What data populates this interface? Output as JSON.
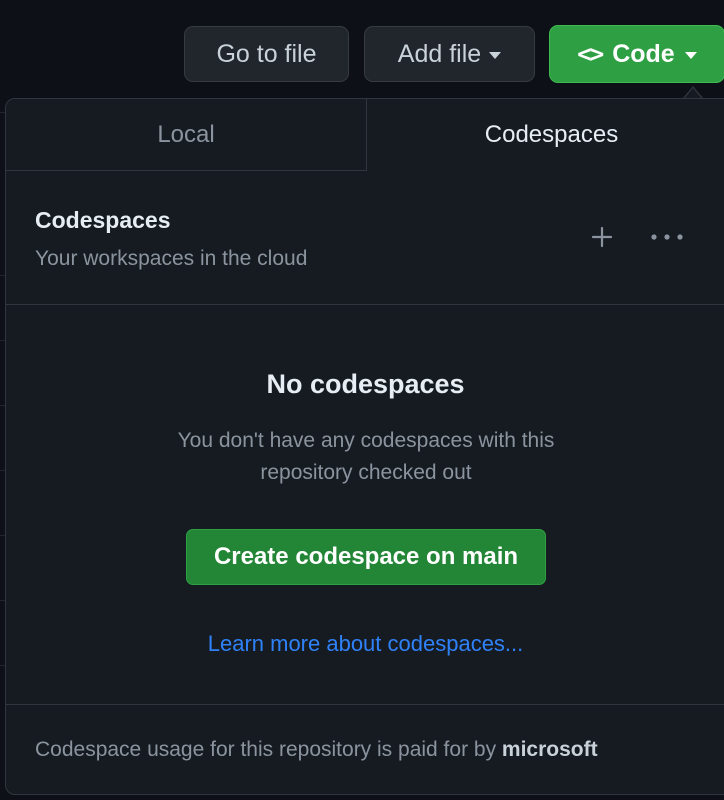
{
  "toolbar": {
    "go_to_file_label": "Go to file",
    "add_file_label": "Add file",
    "code_label": "Code"
  },
  "dropdown": {
    "tabs": [
      {
        "label": "Local",
        "active": false
      },
      {
        "label": "Codespaces",
        "active": true
      }
    ],
    "codespaces": {
      "title": "Codespaces",
      "subtitle": "Your workspaces in the cloud",
      "new_icon": "plus-icon",
      "more_icon": "kebab-horizontal-icon",
      "empty_title": "No codespaces",
      "empty_description": "You don't have any codespaces with this repository checked out",
      "create_button_label": "Create codespace on main",
      "learn_more_link": "Learn more about codespaces...",
      "footer_prefix": "Codespace usage for this repository is paid for by",
      "footer_owner": "microsoft"
    }
  },
  "colors": {
    "background": "#0d1117",
    "panel": "#161b22",
    "border": "#30363d",
    "primary_green": "#238636",
    "link_blue": "#2f81f7",
    "muted_text": "#8b949e",
    "default_text": "#e6edf3"
  }
}
